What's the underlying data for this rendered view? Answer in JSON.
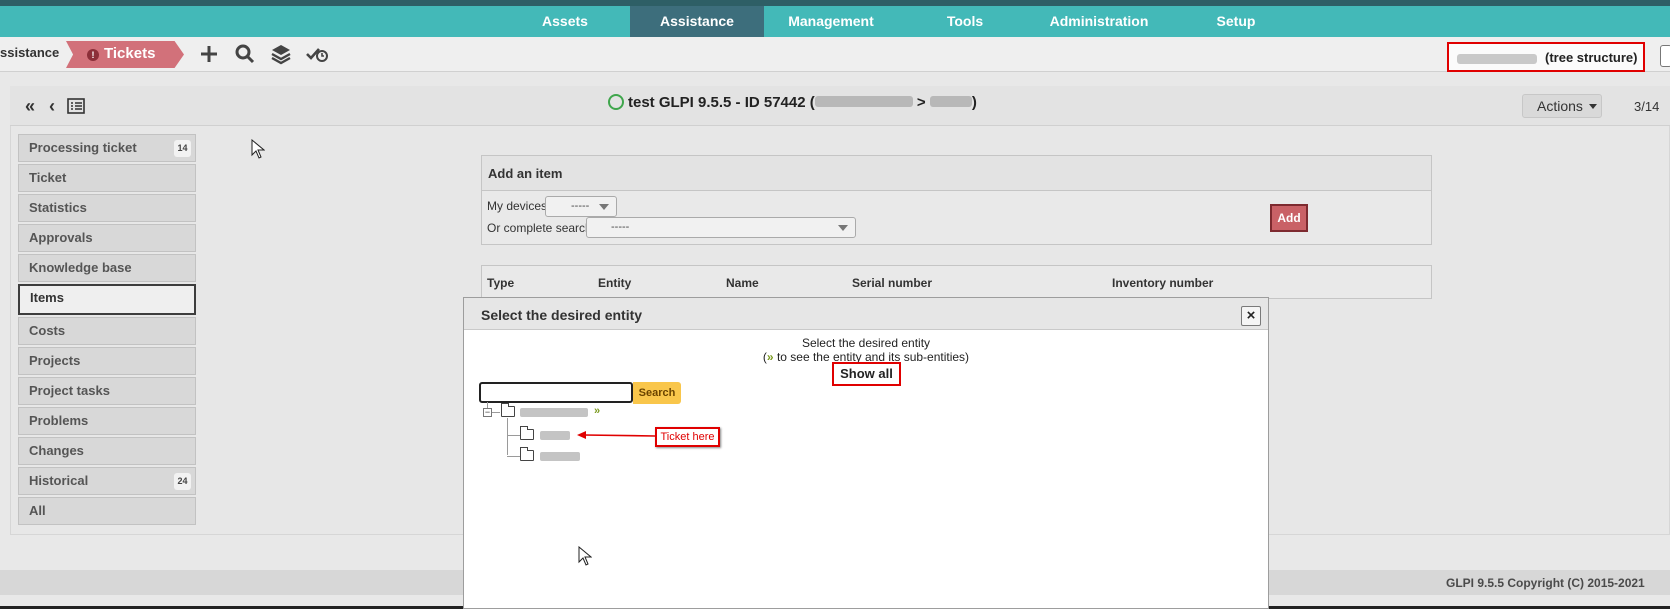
{
  "topnav": {
    "items": [
      {
        "label": "Assets",
        "active": false
      },
      {
        "label": "Assistance",
        "active": true
      },
      {
        "label": "Management",
        "active": false
      },
      {
        "label": "Tools",
        "active": false
      },
      {
        "label": "Administration",
        "active": false
      },
      {
        "label": "Setup",
        "active": false
      }
    ]
  },
  "breadcrumb": {
    "parent": "ssistance",
    "current": "Tickets",
    "current_icon": "exclamation-icon"
  },
  "toolbar": {
    "icons": [
      "plus-icon",
      "search-icon",
      "layers-icon",
      "check-clock-icon"
    ]
  },
  "entity_selector": {
    "label": "(tree structure)"
  },
  "ticket_header": {
    "title_prefix": "test GLPI 9.5.5 - ID 57442 (",
    "separator": ">",
    "title_suffix": ")",
    "status_icon": "circle-new-icon",
    "actions_label": "Actions",
    "pager": "3/14"
  },
  "tabs": [
    {
      "label": "Processing ticket",
      "badge": "14",
      "active": false
    },
    {
      "label": "Ticket",
      "badge": "",
      "active": false
    },
    {
      "label": "Statistics",
      "badge": "",
      "active": false
    },
    {
      "label": "Approvals",
      "badge": "",
      "active": false
    },
    {
      "label": "Knowledge base",
      "badge": "",
      "active": false
    },
    {
      "label": "Items",
      "badge": "",
      "active": true
    },
    {
      "label": "Costs",
      "badge": "",
      "active": false
    },
    {
      "label": "Projects",
      "badge": "",
      "active": false
    },
    {
      "label": "Project tasks",
      "badge": "",
      "active": false
    },
    {
      "label": "Problems",
      "badge": "",
      "active": false
    },
    {
      "label": "Changes",
      "badge": "",
      "active": false
    },
    {
      "label": "Historical",
      "badge": "24",
      "active": false
    },
    {
      "label": "All",
      "badge": "",
      "active": false
    }
  ],
  "add_item": {
    "header": "Add an item",
    "my_devices_label": "My devices",
    "my_devices_value": "-----",
    "complete_search_label": "Or complete search",
    "complete_search_value": "-----",
    "add_button": "Add"
  },
  "items_table": {
    "columns": [
      "Type",
      "Entity",
      "Name",
      "Serial number",
      "Inventory number"
    ]
  },
  "modal": {
    "title": "Select the desired entity",
    "close": "×",
    "line1": "Select the desired entity",
    "line2_prefix": "(",
    "line2_icon": "»",
    "line2_suffix": " to see the entity and its sub-entities)",
    "show_all": "Show all",
    "search_placeholder": "",
    "search_button": "Search",
    "tree_expand_symbol": "−",
    "annotation": "Ticket here"
  },
  "footer": {
    "copyright": "GLPI 9.5.5 Copyright (C) 2015-2021"
  },
  "colors": {
    "nav_bg": "#43b9b8",
    "nav_active": "#3d6e7c",
    "ticket_crumb": "#d2717a",
    "add_button": "#c96166",
    "search_button": "#f9c64b",
    "annotation_red": "#e00000"
  }
}
